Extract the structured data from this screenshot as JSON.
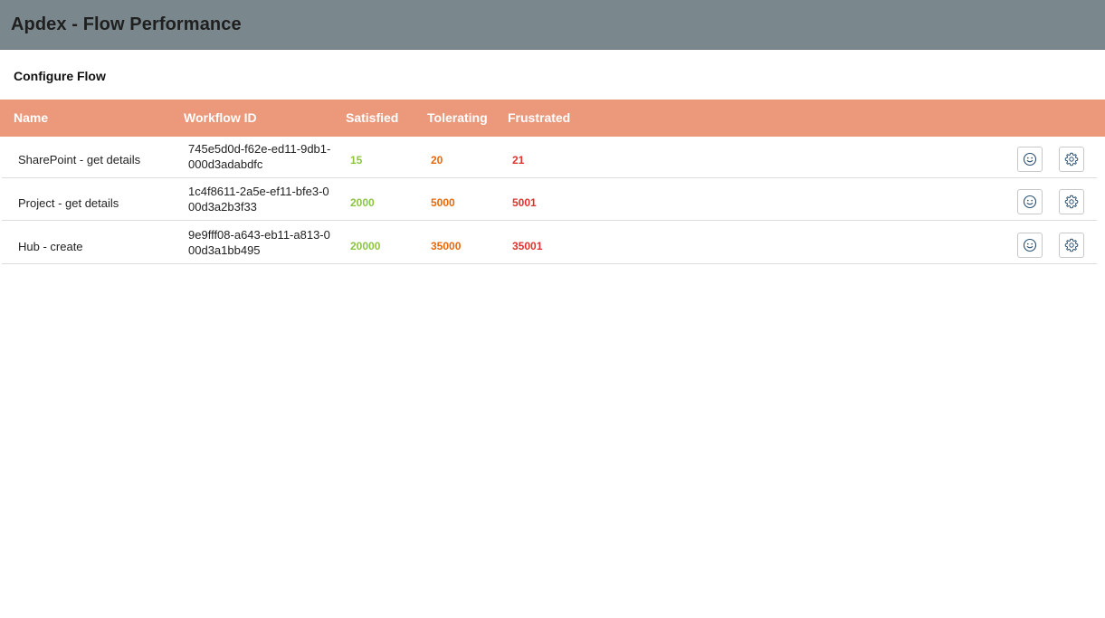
{
  "app": {
    "title": "Apdex - Flow Performance"
  },
  "section": {
    "title": "Configure Flow"
  },
  "colors": {
    "header_bg": "#7a888e",
    "table_header_bg": "#eb987b",
    "satisfied": "#8cc63f",
    "tolerating": "#e8690c",
    "frustrated": "#e0322f",
    "icon": "#2b4f70"
  },
  "table": {
    "columns": {
      "name": "Name",
      "workflow_id": "Workflow ID",
      "satisfied": "Satisfied",
      "tolerating": "Tolerating",
      "frustrated": "Frustrated"
    },
    "rows": [
      {
        "name": "SharePoint - get details",
        "workflow_id": "745e5d0d-f62e-ed11-9db1-000d3adabdfc",
        "satisfied": "15",
        "tolerating": "20",
        "frustrated": "21",
        "icons": [
          "smile-icon",
          "gear-icon"
        ]
      },
      {
        "name": "Project - get details",
        "workflow_id": "1c4f8611-2a5e-ef11-bfe3-000d3a2b3f33",
        "satisfied": "2000",
        "tolerating": "5000",
        "frustrated": "5001",
        "icons": [
          "smile-icon",
          "gear-icon"
        ]
      },
      {
        "name": "Hub - create",
        "workflow_id": "9e9fff08-a643-eb11-a813-000d3a1bb495",
        "satisfied": "20000",
        "tolerating": "35000",
        "frustrated": "35001",
        "icons": [
          "smile-icon",
          "gear-icon"
        ]
      }
    ]
  }
}
